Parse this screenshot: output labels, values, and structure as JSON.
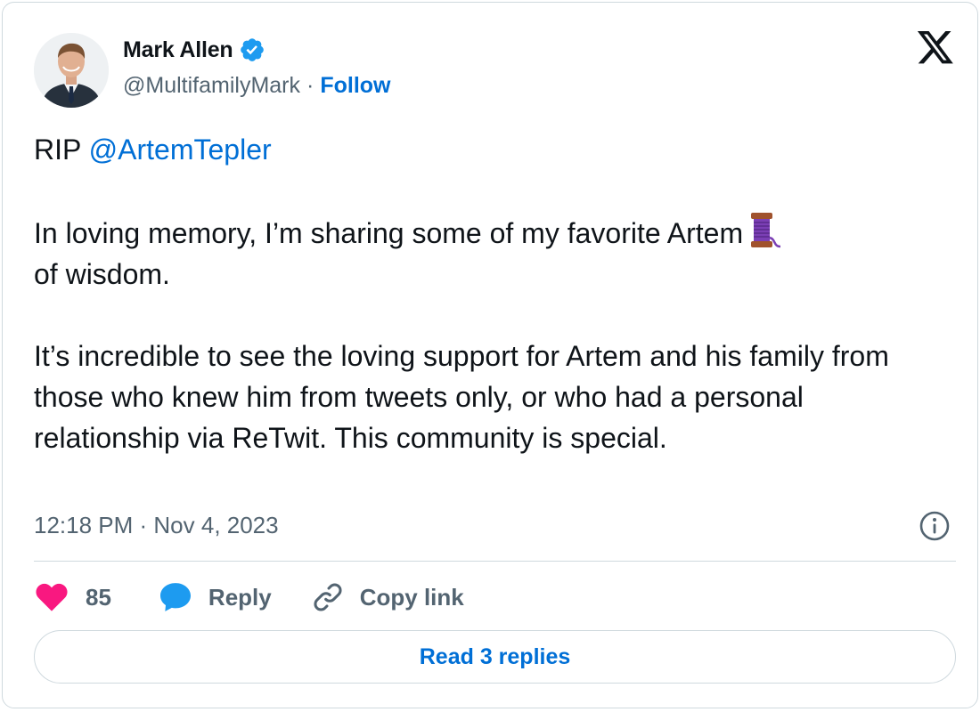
{
  "author": {
    "display_name": "Mark Allen",
    "handle": "@MultifamilyMark",
    "separator": "·",
    "follow_label": "Follow",
    "verified": true
  },
  "tweet": {
    "prefix": "RIP ",
    "mention": "@ArtemTepler",
    "paragraph2_before": "In loving memory, I’m sharing some of my favorite Artem",
    "paragraph2_emoji": "spool-of-thread",
    "paragraph2_after": "of wisdom.",
    "paragraph3": "It’s incredible to see the loving support for Artem and his family from those who knew him from tweets only, or who had a personal relationship via ReTwit. This community is special."
  },
  "timestamp": "12:18 PM · Nov 4, 2023",
  "actions": {
    "like_count": "85",
    "reply_label": "Reply",
    "copy_link_label": "Copy link"
  },
  "read_replies_label": "Read 3 replies",
  "icons": {
    "brand_logo": "x-logo-icon",
    "verified": "verified-badge-icon",
    "like": "heart-icon",
    "reply": "speech-bubble-icon",
    "copy": "link-icon",
    "info": "info-icon"
  },
  "colors": {
    "accent": "#006fd6",
    "verified": "#1d9bf0",
    "like": "#f91880",
    "muted": "#536471",
    "text": "#0f1419",
    "border": "#cfd9de"
  }
}
